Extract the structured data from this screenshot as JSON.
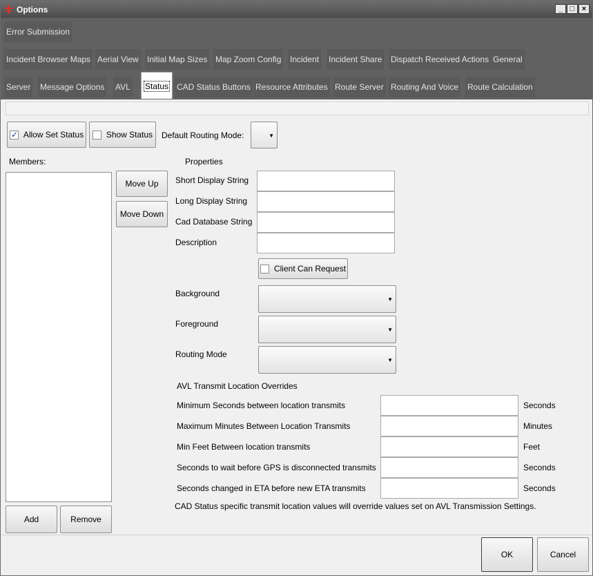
{
  "window": {
    "title": "Options",
    "minimize_glyph": "_",
    "maximize_glyph": "□",
    "close_glyph": "×"
  },
  "tabs": {
    "row1": [
      "Error Submission"
    ],
    "row2": [
      "Incident Browser Maps",
      "Aerial View",
      "Initial Map Sizes",
      "Map Zoom Config",
      "Incident",
      "Incident Share",
      "Dispatch Received Actions",
      "General"
    ],
    "row3": [
      "Server",
      "Message Options",
      "AVL",
      "Status",
      "CAD Status Buttons",
      "Resource Attributes",
      "Route Server",
      "Routing And Voice",
      "Route Calculation"
    ],
    "active": "Status"
  },
  "toolbar": {
    "allow_set_status": {
      "label": "Allow Set Status",
      "checked": true
    },
    "show_status": {
      "label": "Show Status",
      "checked": false
    },
    "default_routing_mode_label": "Default Routing Mode:",
    "default_routing_mode_value": ""
  },
  "members": {
    "label": "Members:",
    "items": [],
    "move_up": "Move Up",
    "move_down": "Move Down",
    "add": "Add",
    "remove": "Remove"
  },
  "properties": {
    "heading": "Properties",
    "short_display_label": "Short Display String",
    "short_display_value": "",
    "long_display_label": "Long Display String",
    "long_display_value": "",
    "cad_db_label": "Cad Database String",
    "cad_db_value": "",
    "description_label": "Description",
    "description_value": "",
    "client_can_request": {
      "label": "Client Can Request",
      "checked": false
    },
    "background_label": "Background",
    "background_value": "",
    "foreground_label": "Foreground",
    "foreground_value": "",
    "routing_mode_label": "Routing Mode",
    "routing_mode_value": ""
  },
  "avl": {
    "heading": "AVL Transmit Location Overrides",
    "rows": [
      {
        "label": "Minimum Seconds between location transmits",
        "value": "",
        "unit": "Seconds"
      },
      {
        "label": "Maximum Minutes Between Location Transmits",
        "value": "",
        "unit": "Minutes"
      },
      {
        "label": "Min Feet Between location transmits",
        "value": "",
        "unit": "Feet"
      },
      {
        "label": "Seconds to wait before GPS is disconnected transmits",
        "value": "",
        "unit": "Seconds"
      },
      {
        "label": "Seconds changed in ETA before new ETA transmits",
        "value": "",
        "unit": "Seconds"
      }
    ],
    "note": "CAD Status specific transmit location values will override values set on AVL Transmission Settings."
  },
  "footer": {
    "ok": "OK",
    "cancel": "Cancel"
  }
}
